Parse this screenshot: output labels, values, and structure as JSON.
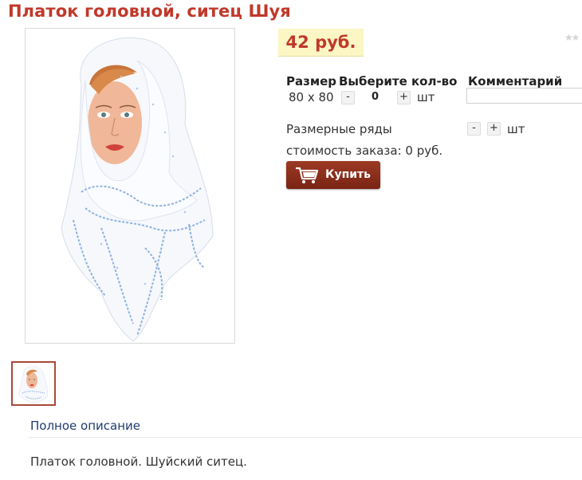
{
  "product": {
    "title": "Платок головной, ситец Шуя",
    "price": "42 руб.",
    "rating_stars": "★★"
  },
  "table": {
    "headers": [
      "Размер",
      "Выберите кол-во",
      "Комментарий"
    ],
    "row": {
      "size": "80 x 80",
      "minus": "-",
      "quantity": "0",
      "plus": "+",
      "unit": "шт",
      "comment_value": ""
    }
  },
  "size_rows": {
    "label": "Размерные ряды",
    "minus": "-",
    "plus": "+",
    "unit": "шт"
  },
  "order_cost": "стоимость заказа: 0 руб.",
  "buy_button": {
    "label": "Купить",
    "icon": "shopping-cart-icon"
  },
  "description": {
    "tab_label": "Полное описание",
    "text": "Платок головной. Шуйский ситец."
  },
  "colors": {
    "title": "#c0392b",
    "price_bg": "#fbf6c3",
    "button": "#8b2f1c",
    "link": "#1f3b6e"
  }
}
